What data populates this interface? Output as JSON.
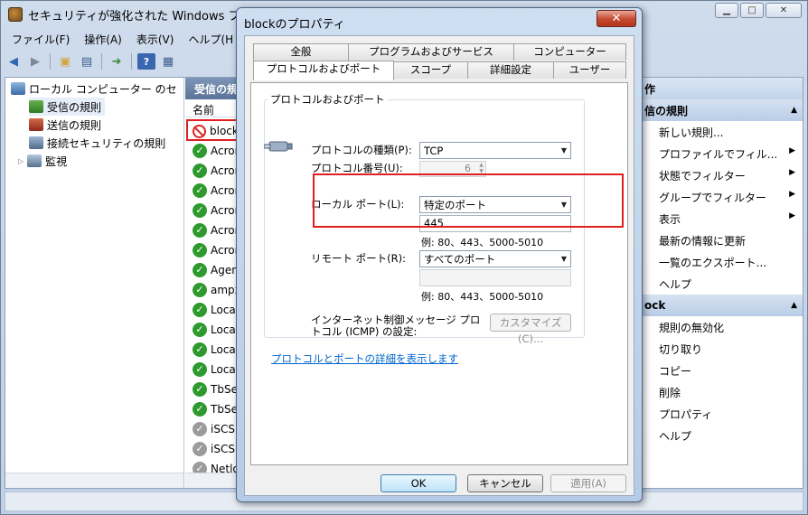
{
  "main": {
    "title": "セキュリティが強化された Windows ファ",
    "menu": [
      "ファイル(F)",
      "操作(A)",
      "表示(V)",
      "ヘルプ(H"
    ]
  },
  "tree": {
    "root": "ローカル コンピューター のセ",
    "items": [
      "受信の規則",
      "送信の規則",
      "接続セキュリティの規則",
      "監視"
    ]
  },
  "middle": {
    "header": "受信の規",
    "column_name": "名前",
    "rules": [
      {
        "label": "block",
        "state": "blocked"
      },
      {
        "label": "Acron",
        "state": "enabled"
      },
      {
        "label": "Acron",
        "state": "enabled"
      },
      {
        "label": "Acron",
        "state": "enabled"
      },
      {
        "label": "Acron",
        "state": "enabled"
      },
      {
        "label": "Acron",
        "state": "enabled"
      },
      {
        "label": "Acron",
        "state": "enabled"
      },
      {
        "label": "Agent",
        "state": "enabled"
      },
      {
        "label": "ampx",
        "state": "enabled"
      },
      {
        "label": "Local",
        "state": "enabled"
      },
      {
        "label": "Local",
        "state": "enabled"
      },
      {
        "label": "Local",
        "state": "enabled"
      },
      {
        "label": "Local",
        "state": "enabled"
      },
      {
        "label": "TbSer",
        "state": "enabled"
      },
      {
        "label": "TbSer",
        "state": "enabled"
      },
      {
        "label": "iSCSI",
        "state": "disabled"
      },
      {
        "label": "iSCSI",
        "state": "disabled"
      },
      {
        "label": "Netlog",
        "state": "disabled"
      }
    ]
  },
  "actions": {
    "header1": "作",
    "section1": "信の規則",
    "items1": [
      {
        "label": "新しい規則...",
        "arrow": ""
      },
      {
        "label": "プロファイルでフィル...",
        "arrow": "▶"
      },
      {
        "label": "状態でフィルター",
        "arrow": "▶"
      },
      {
        "label": "グループでフィルター",
        "arrow": "▶"
      },
      {
        "label": "表示",
        "arrow": "▶"
      },
      {
        "label": "最新の情報に更新",
        "arrow": ""
      },
      {
        "label": "一覧のエクスポート...",
        "arrow": ""
      },
      {
        "label": "ヘルプ",
        "arrow": ""
      }
    ],
    "section2": "ock",
    "items2": [
      {
        "label": "規則の無効化",
        "arrow": ""
      },
      {
        "label": "切り取り",
        "arrow": ""
      },
      {
        "label": "コピー",
        "arrow": ""
      },
      {
        "label": "削除",
        "arrow": ""
      },
      {
        "label": "プロパティ",
        "arrow": ""
      },
      {
        "label": "ヘルプ",
        "arrow": ""
      }
    ]
  },
  "dialog": {
    "title": "blockのプロパティ",
    "close": "✕",
    "tabs_row1": [
      "全般",
      "プログラムおよびサービス",
      "コンピューター"
    ],
    "tabs_row2": [
      "プロトコルおよびポート",
      "スコープ",
      "詳細設定",
      "ユーザー"
    ],
    "group_title": "プロトコルおよびポート",
    "protocol_type_label": "プロトコルの種類(P):",
    "protocol_type_value": "TCP",
    "protocol_number_label": "プロトコル番号(U):",
    "protocol_number_value": "6",
    "local_port_label": "ローカル ポート(L):",
    "local_port_value": "特定のポート",
    "local_port_input": "445",
    "local_port_hint": "例: 80、443、5000-5010",
    "remote_port_label": "リモート ポート(R):",
    "remote_port_value": "すべてのポート",
    "remote_port_input": "",
    "remote_port_hint": "例: 80、443、5000-5010",
    "icmp_label": "インターネット制御メッセージ プロトコル (ICMP) の設定:",
    "customize_button": "カスタマイズ(C)...",
    "detail_link": "プロトコルとポートの詳細を表示します",
    "ok": "OK",
    "cancel": "キャンセル",
    "apply": "適用(A)"
  }
}
